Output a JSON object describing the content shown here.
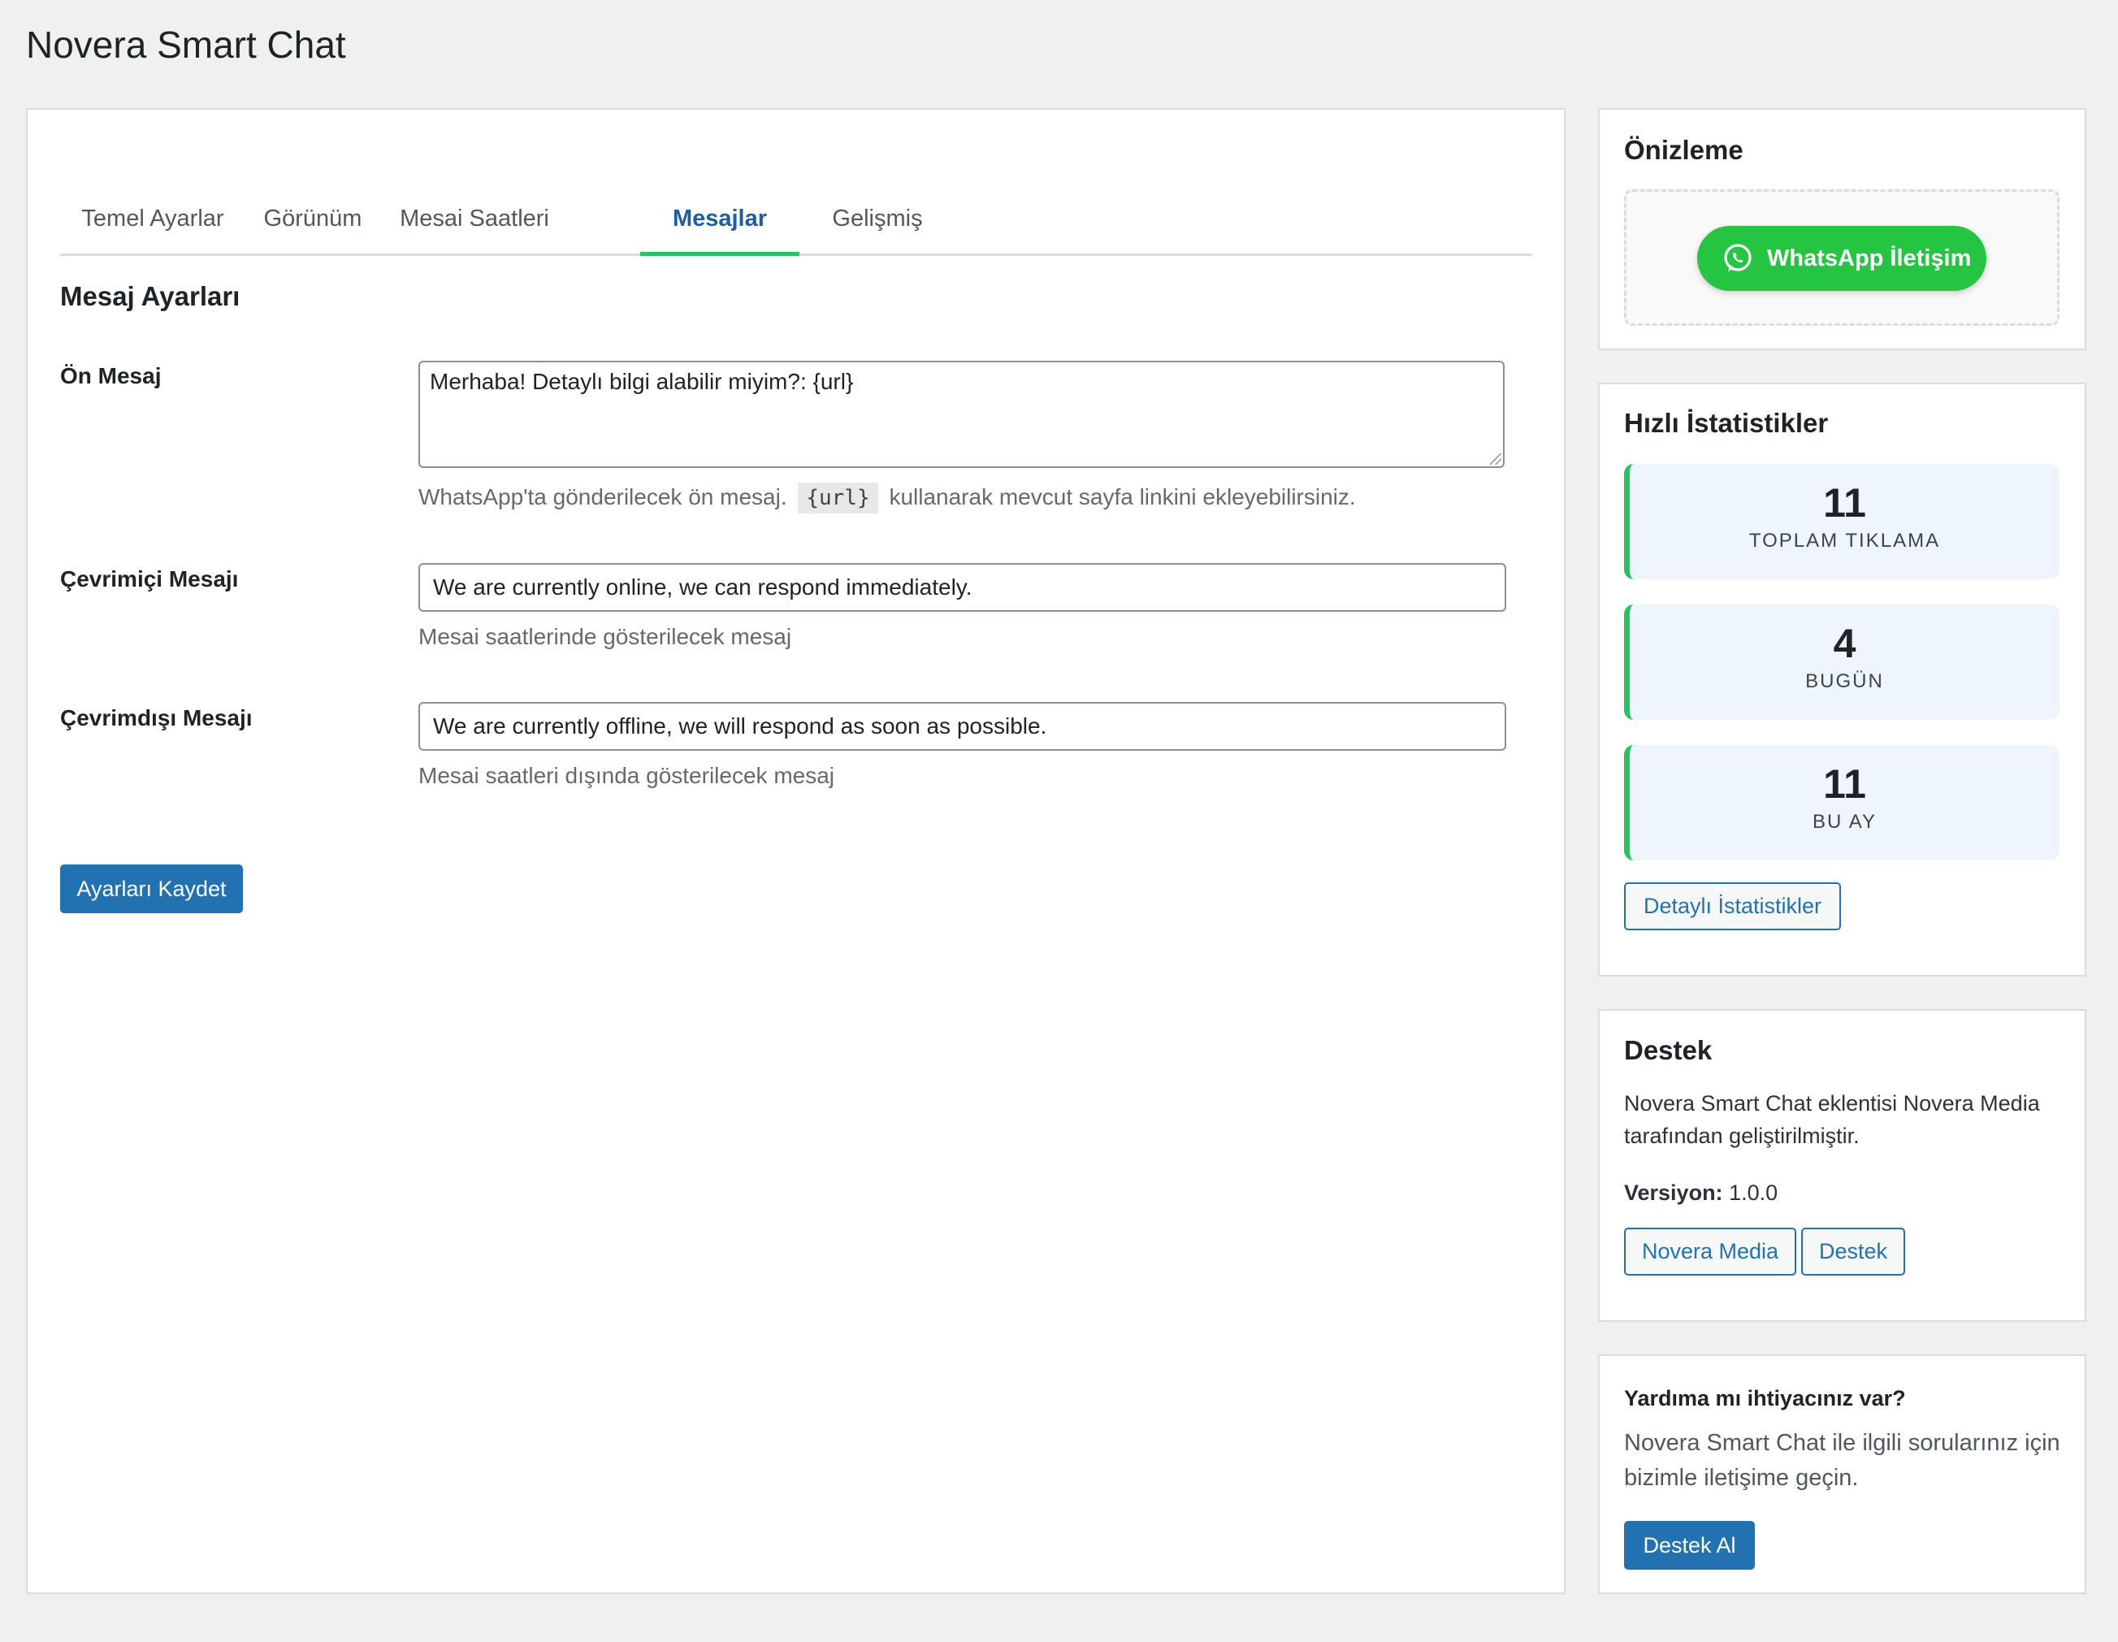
{
  "page": {
    "title": "Novera Smart Chat"
  },
  "tabs": [
    {
      "label": "Temel Ayarlar",
      "active": false
    },
    {
      "label": "Görünüm",
      "active": false
    },
    {
      "label": "Mesai Saatleri",
      "active": false
    },
    {
      "label": "Mesajlar",
      "active": true
    },
    {
      "label": "Gelişmiş",
      "active": false
    }
  ],
  "section": {
    "title": "Mesaj Ayarları"
  },
  "fields": {
    "pre_message": {
      "label": "Ön Mesaj",
      "value": "Merhaba! Detaylı bilgi alabilir miyim?: {url}",
      "desc_before": "WhatsApp'ta gönderilecek ön mesaj.",
      "desc_code": "{url}",
      "desc_after": "kullanarak mevcut sayfa linkini ekleyebilirsiniz."
    },
    "online_message": {
      "label": "Çevrimiçi Mesajı",
      "value": "We are currently online, we can respond immediately.",
      "desc": "Mesai saatlerinde gösterilecek mesaj"
    },
    "offline_message": {
      "label": "Çevrimdışı Mesajı",
      "value": "We are currently offline, we will respond as soon as possible.",
      "desc": "Mesai saatleri dışında gösterilecek mesaj"
    }
  },
  "save_button": {
    "label": "Ayarları Kaydet"
  },
  "preview": {
    "title": "Önizleme",
    "button_label": "WhatsApp İletişim",
    "button_icon": "whatsapp-icon",
    "button_color": "#25c442"
  },
  "stats": {
    "title": "Hızlı İstatistikler",
    "items": [
      {
        "value": "11",
        "label": "TOPLAM TIKLAMA"
      },
      {
        "value": "4",
        "label": "BUGÜN"
      },
      {
        "value": "11",
        "label": "BU AY"
      }
    ],
    "details_button": "Detaylı İstatistikler",
    "accent_color": "#25c45f"
  },
  "support": {
    "title": "Destek",
    "text": "Novera Smart Chat eklentisi Novera Media tarafından geliştirilmiştir.",
    "version_label": "Versiyon:",
    "version_value": "1.0.0",
    "buttons": [
      "Novera Media",
      "Destek"
    ]
  },
  "help": {
    "title": "Yardıma mı ihtiyacınız var?",
    "text": "Novera Smart Chat ile ilgili sorularınız için bizimle iletişime geçin.",
    "button": "Destek Al"
  },
  "colors": {
    "primary": "#2271b1",
    "active_tab_text": "#1d5ea3",
    "active_tab_underline": "#25c45f",
    "background": "#f0f0f1"
  }
}
